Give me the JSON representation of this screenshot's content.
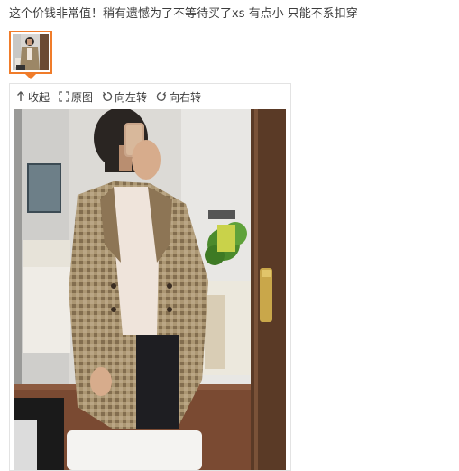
{
  "review": {
    "text": "这个价钱非常值！稍有遗憾为了不等待买了xs 有点小 只能不系扣穿"
  },
  "thumbnail": {
    "selected": true
  },
  "toolbar": {
    "collapse_label": "收起",
    "original_label": "原图",
    "rotate_left_label": "向左转",
    "rotate_right_label": "向右转"
  },
  "colors": {
    "accent": "#f07c2a",
    "text": "#3c3c3c",
    "border": "#e3e3e3"
  },
  "icons": [
    "collapse-arrow-icon",
    "fullscreen-icon",
    "rotate-left-icon",
    "rotate-right-icon"
  ]
}
